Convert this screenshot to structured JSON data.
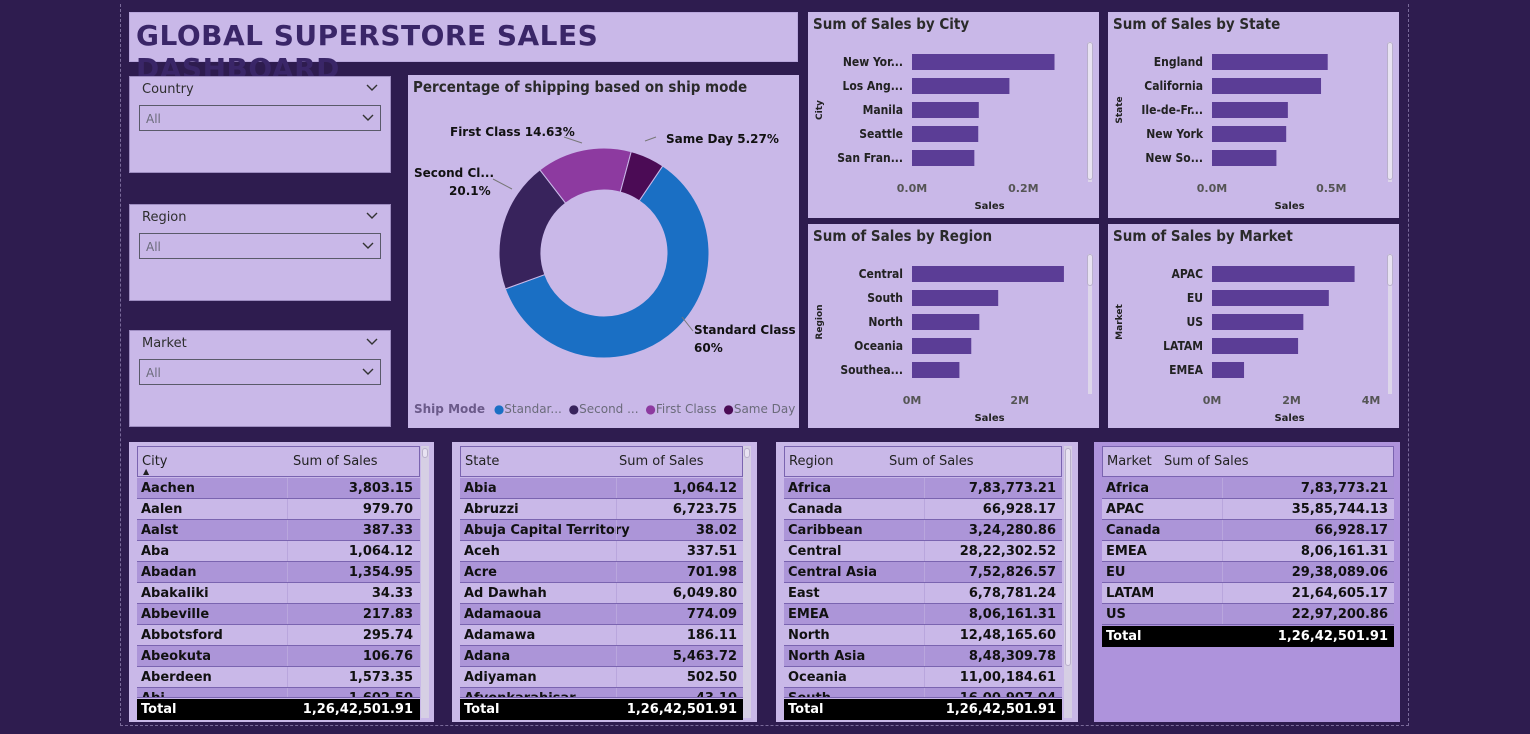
{
  "title": "GLOBAL SUPERSTORE SALES DASHBOARD",
  "slicers": [
    {
      "label": "Country",
      "value": "All"
    },
    {
      "label": "Region",
      "value": "All"
    },
    {
      "label": "Market",
      "value": "All"
    }
  ],
  "donut": {
    "title": "Percentage of shipping based on ship mode",
    "legend_title": "Ship Mode",
    "labels": {
      "first": "First Class 14.63%",
      "same": "Same Day 5.27%",
      "second_a": "Second Cl...",
      "second_b": "20.1%",
      "std_a": "Standard Class",
      "std_b": "60%"
    },
    "legend": [
      "Standar...",
      "Second ...",
      "First Class",
      "Same Day"
    ]
  },
  "chart_data": [
    {
      "type": "pie",
      "title": "Percentage of shipping based on ship mode",
      "categories": [
        "Standard Class",
        "Second Class",
        "First Class",
        "Same Day"
      ],
      "values": [
        60,
        20.1,
        14.63,
        5.27
      ],
      "colors": [
        "#1a6fc4",
        "#38235c",
        "#8d3aa0",
        "#4b0b55"
      ],
      "legend_title": "Ship Mode"
    },
    {
      "type": "bar",
      "title": "Sum of Sales by City",
      "categories": [
        "New Yor...",
        "Los Ang...",
        "Manila",
        "Seattle",
        "San Fran..."
      ],
      "values": [
        0.256,
        0.175,
        0.12,
        0.119,
        0.112
      ],
      "xlabel": "Sales",
      "ylabel": "City",
      "ticks": [
        "0.0M",
        "0.2M"
      ],
      "xlim": [
        0,
        0.3
      ]
    },
    {
      "type": "bar",
      "title": "Sum of Sales by State",
      "categories": [
        "England",
        "California",
        "Ile-de-Fr...",
        "New York",
        "New So..."
      ],
      "values": [
        0.485,
        0.457,
        0.318,
        0.311,
        0.27
      ],
      "xlabel": "Sales",
      "ylabel": "State",
      "ticks": [
        "0.0M",
        "0.5M"
      ],
      "xlim": [
        0,
        0.7
      ]
    },
    {
      "type": "bar",
      "title": "Sum of Sales by Region",
      "categories": [
        "Central",
        "South",
        "North",
        "Oceania",
        "Southea..."
      ],
      "values": [
        2.82,
        1.6,
        1.25,
        1.1,
        0.88
      ],
      "xlabel": "Sales",
      "ylabel": "Region",
      "ticks": [
        "0M",
        "2M"
      ],
      "xlim": [
        0,
        3.1
      ]
    },
    {
      "type": "bar",
      "title": "Sum of Sales by Market",
      "categories": [
        "APAC",
        "EU",
        "US",
        "LATAM",
        "EMEA"
      ],
      "values": [
        3.586,
        2.938,
        2.297,
        2.165,
        0.806
      ],
      "xlabel": "Sales",
      "ylabel": "Market",
      "ticks": [
        "0M",
        "2M",
        "4M"
      ],
      "xlim": [
        0,
        4.2
      ]
    }
  ],
  "tables": {
    "city": {
      "headers": [
        "City",
        "Sum of Sales"
      ],
      "rows": [
        [
          "Aachen",
          "3,803.15"
        ],
        [
          "Aalen",
          "979.70"
        ],
        [
          "Aalst",
          "387.33"
        ],
        [
          "Aba",
          "1,064.12"
        ],
        [
          "Abadan",
          "1,354.95"
        ],
        [
          "Abakaliki",
          "34.33"
        ],
        [
          "Abbeville",
          "217.83"
        ],
        [
          "Abbotsford",
          "295.74"
        ],
        [
          "Abeokuta",
          "106.76"
        ],
        [
          "Aberdeen",
          "1,573.35"
        ]
      ],
      "partial": [
        "Abi...",
        "1,602.50"
      ],
      "total": [
        "Total",
        "1,26,42,501.91"
      ]
    },
    "state": {
      "headers": [
        "State",
        "Sum of Sales"
      ],
      "rows": [
        [
          "Abia",
          "1,064.12"
        ],
        [
          "Abruzzi",
          "6,723.75"
        ],
        [
          "Abuja Capital Territory",
          "38.02"
        ],
        [
          "Aceh",
          "337.51"
        ],
        [
          "Acre",
          "701.98"
        ],
        [
          "Ad Dawhah",
          "6,049.80"
        ],
        [
          "Adamaoua",
          "774.09"
        ],
        [
          "Adamawa",
          "186.11"
        ],
        [
          "Adana",
          "5,463.72"
        ],
        [
          "Adiyaman",
          "502.50"
        ]
      ],
      "partial": [
        "Afyonkarahisar",
        "43.10"
      ],
      "total": [
        "Total",
        "1,26,42,501.91"
      ]
    },
    "region": {
      "headers": [
        "Region",
        "Sum of Sales"
      ],
      "rows": [
        [
          "Africa",
          "7,83,773.21"
        ],
        [
          "Canada",
          "66,928.17"
        ],
        [
          "Caribbean",
          "3,24,280.86"
        ],
        [
          "Central",
          "28,22,302.52"
        ],
        [
          "Central Asia",
          "7,52,826.57"
        ],
        [
          "East",
          "6,78,781.24"
        ],
        [
          "EMEA",
          "8,06,161.31"
        ],
        [
          "North",
          "12,48,165.60"
        ],
        [
          "North Asia",
          "8,48,309.78"
        ],
        [
          "Oceania",
          "11,00,184.61"
        ]
      ],
      "partial": [
        "South",
        "16,00,907.04"
      ],
      "total": [
        "Total",
        "1,26,42,501.91"
      ]
    },
    "market": {
      "headers": [
        "Market",
        "Sum of Sales"
      ],
      "rows": [
        [
          "Africa",
          "7,83,773.21"
        ],
        [
          "APAC",
          "35,85,744.13"
        ],
        [
          "Canada",
          "66,928.17"
        ],
        [
          "EMEA",
          "8,06,161.31"
        ],
        [
          "EU",
          "29,38,089.06"
        ],
        [
          "LATAM",
          "21,64,605.17"
        ],
        [
          "US",
          "22,97,200.86"
        ]
      ],
      "total": [
        "Total",
        "1,26,42,501.91"
      ]
    }
  },
  "colors": {
    "background": "#2e1c4f",
    "panel": "#c9b8e8",
    "bar": "#5b3d96",
    "title": "#3a2668"
  }
}
